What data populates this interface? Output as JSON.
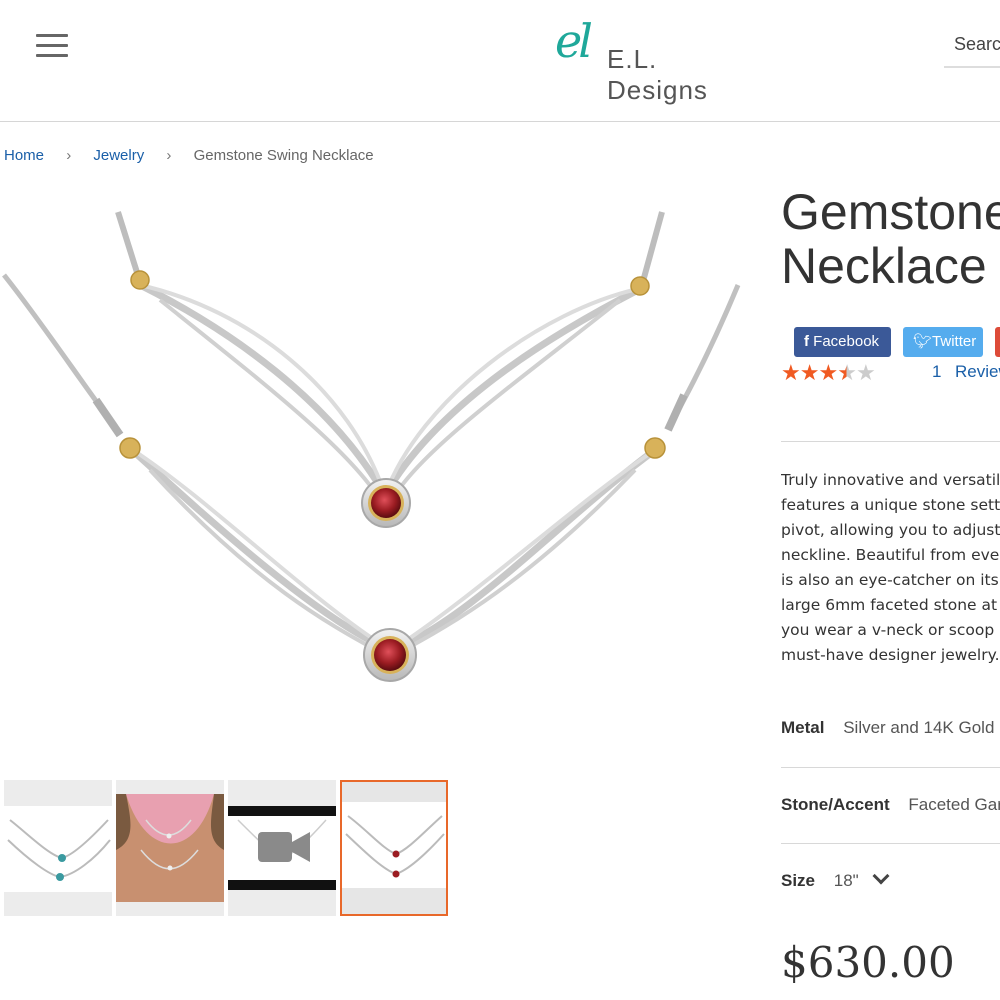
{
  "header": {
    "logo_mark": "el",
    "logo_text": "E.L. Designs",
    "search_placeholder": "Search"
  },
  "breadcrumb": {
    "items": [
      "Home",
      "Jewelry"
    ],
    "current": "Gemstone Swing Necklace"
  },
  "product": {
    "title_line1": "Gemstone Swing",
    "title_line2": "Necklace",
    "share": {
      "facebook": "Facebook",
      "twitter": "Twitter"
    },
    "rating": 3.5,
    "rating_max": 5,
    "review_count": "1",
    "review_label": "Reviews",
    "description": "Truly innovative and versatile, this necklace features a unique stone setting that acts as a pivot, allowing you to adjust the necklace for any neckline. Beautiful from every angle, the necklace is also an eye-catcher on its own, showcasing a large 6mm faceted stone at its center. Whether you wear a v-neck or scoop neck, this necklace is a must-have designer jewelry.",
    "metal_label": "Metal",
    "metal_value": "Silver and 14K Gold",
    "stone_label": "Stone/Accent",
    "stone_value": "Faceted Garnet",
    "size_label": "Size",
    "size_value": "18\"",
    "price": "$630.00"
  },
  "colors": {
    "accent_orange": "#e8682a",
    "link_blue": "#1a5fa8",
    "facebook": "#3b5998",
    "twitter": "#55acee",
    "logo_teal": "#1fa89a",
    "garnet": "#9b1c22",
    "gold": "#d8b25a"
  }
}
